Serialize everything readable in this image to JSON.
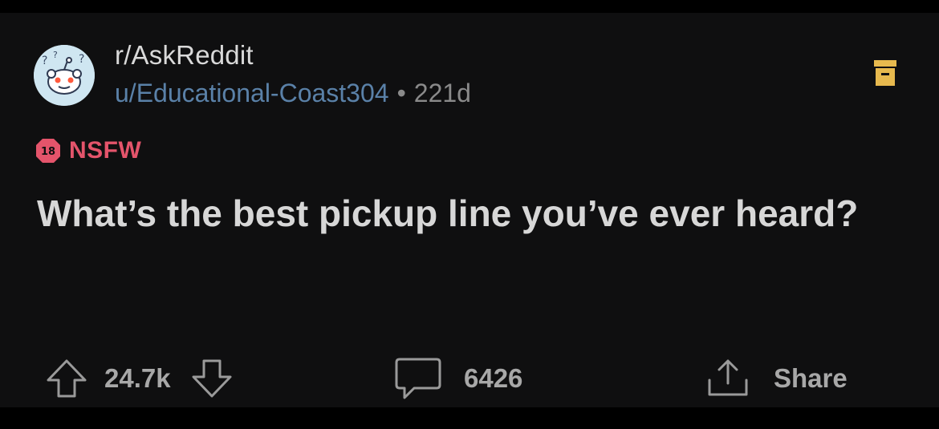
{
  "post": {
    "subreddit": "r/AskReddit",
    "author": "u/Educational-Coast304",
    "separator": "•",
    "age": "221d",
    "nsfw_badge": "18",
    "nsfw_label": "NSFW",
    "title": "What’s the best pickup line you’ve ever heard?"
  },
  "actions": {
    "score": "24.7k",
    "comments": "6426",
    "share_label": "Share"
  },
  "icons": {
    "avatar": "askreddit-snoo-avatar",
    "archive": "archive-box-icon",
    "nsfw": "nsfw-18-badge-icon",
    "upvote": "upvote-arrow-icon",
    "downvote": "downvote-arrow-icon",
    "comment": "comment-bubble-icon",
    "share": "share-icon"
  },
  "colors": {
    "background": "#0f0f10",
    "title_text": "#d7d7d7",
    "subreddit_text": "#d9d9d9",
    "author_text": "#5a81a8",
    "meta_text": "#8a8a8a",
    "nsfw": "#e4546b",
    "archive": "#e7b94e",
    "action_text": "#a8a8a8"
  }
}
